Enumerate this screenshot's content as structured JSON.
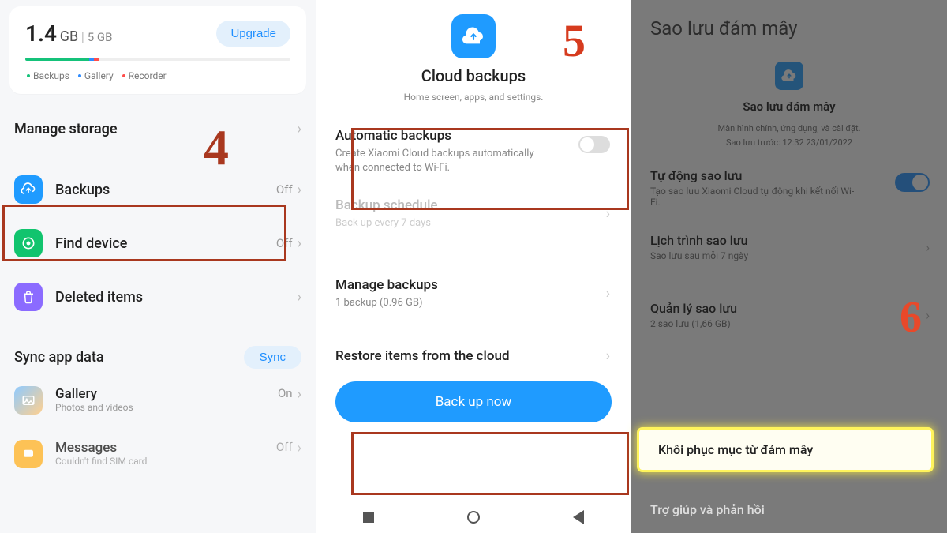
{
  "panel1": {
    "storage": {
      "used_value": "1.4",
      "used_unit": "GB",
      "total": "5 GB",
      "upgrade": "Upgrade",
      "legend": {
        "backups": "Backups",
        "gallery": "Gallery",
        "recorder": "Recorder"
      }
    },
    "manage_storage": "Manage storage",
    "backups": {
      "label": "Backups",
      "state": "Off"
    },
    "find_device": {
      "label": "Find device",
      "state": "Off"
    },
    "deleted_items": {
      "label": "Deleted items"
    },
    "sync_section": "Sync app data",
    "sync_button": "Sync",
    "gallery": {
      "label": "Gallery",
      "desc": "Photos and videos",
      "state": "On"
    },
    "messages": {
      "label": "Messages",
      "desc": "Couldn't find SIM card",
      "state": "Off"
    },
    "step": "4"
  },
  "panel2": {
    "title": "Cloud backups",
    "subtitle": "Home screen, apps, and settings.",
    "auto": {
      "title": "Automatic backups",
      "desc": "Create Xiaomi Cloud backups automatically when connected to Wi-Fi."
    },
    "schedule": {
      "title": "Backup schedule",
      "desc": "Back up every 7 days"
    },
    "manage": {
      "title": "Manage backups",
      "desc": "1 backup (0.96 GB)"
    },
    "restore": {
      "title": "Restore items from the cloud"
    },
    "button": "Back up now",
    "step": "5"
  },
  "panel3": {
    "header": "Sao lưu đám mây",
    "card": {
      "title": "Sao lưu đám mây",
      "line1": "Màn hình chính, ứng dụng, và cài đặt.",
      "line2": "Sao lưu trước: 12:32 23/01/2022"
    },
    "auto": {
      "title": "Tự động sao lưu",
      "desc": "Tạo sao lưu Xiaomi Cloud tự động khi kết nối Wi-Fi."
    },
    "schedule": {
      "title": "Lịch trình sao lưu",
      "desc": "Sao lưu sau mỗi 7 ngày"
    },
    "manage": {
      "title": "Quản lý sao lưu",
      "desc": "2 sao lưu (1,66 GB)"
    },
    "restore": "Khôi phục mục từ đám mây",
    "help": "Trợ giúp và phản hồi",
    "step": "6"
  }
}
